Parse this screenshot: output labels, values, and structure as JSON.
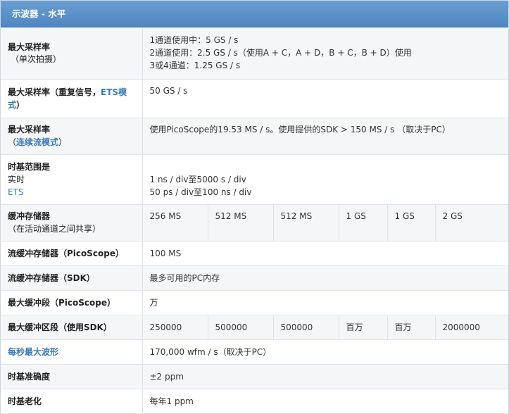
{
  "header": "示波器 - 水平",
  "rows": {
    "max_sample_rate": {
      "label": "最大采样率",
      "label_sub": "（单次拍摄）",
      "values": [
        "1通道使用中：5 GS / s",
        "2通道使用：2.5 GS / s（使用A + C，A + D，B + C，B + D）使用",
        "3或4通道：1.25 GS / s"
      ]
    },
    "max_sample_rate_ets": {
      "label_a": "最大采样率（重复信号，",
      "label_link": "ETS模式",
      "label_b": "）",
      "value": "50 GS / s"
    },
    "max_sample_rate_stream": {
      "label": "最大采样率",
      "label_open": "（",
      "label_link": "连续流模式",
      "label_close": "）",
      "value": "使用PicoScope的19.53 MS / s。使用提供的SDK > 150 MS / s （取决于PC）"
    },
    "timebase_range": {
      "label": "时基范围是",
      "label_realtime": "实时",
      "label_ets": "ETS",
      "values": [
        "1 ns / div至5000 s / div",
        "50 ps / div至100 ns / div"
      ]
    },
    "buffer_memory": {
      "label": "缓冲存储器",
      "label_sub": "（在活动通道之间共享）",
      "values": [
        "256 MS",
        "512 MS",
        "512 MS",
        "1 GS",
        "1 GS",
        "2 GS"
      ]
    },
    "stream_buffer_picoscope": {
      "label": "流缓冲存储器（PicoScope）",
      "value": "100 MS"
    },
    "stream_buffer_sdk": {
      "label": "流缓冲存储器（SDK）",
      "value": "最多可用的PC内存"
    },
    "max_segments_picoscope": {
      "label": "最大缓冲段（PicoScope）",
      "value": "万"
    },
    "max_segments_sdk": {
      "label": "最大缓冲区段（使用SDK）",
      "values": [
        "250000",
        "500000",
        "500000",
        "百万",
        "百万",
        "2000000"
      ]
    },
    "max_waveforms": {
      "label": "每秒最大波形",
      "value": "170,000 wfm / s（取决于PC）"
    },
    "timebase_accuracy": {
      "label": "时基准确度",
      "value": "±2 ppm"
    },
    "timebase_aging": {
      "label": "时基老化",
      "value": "每年1 ppm"
    }
  }
}
